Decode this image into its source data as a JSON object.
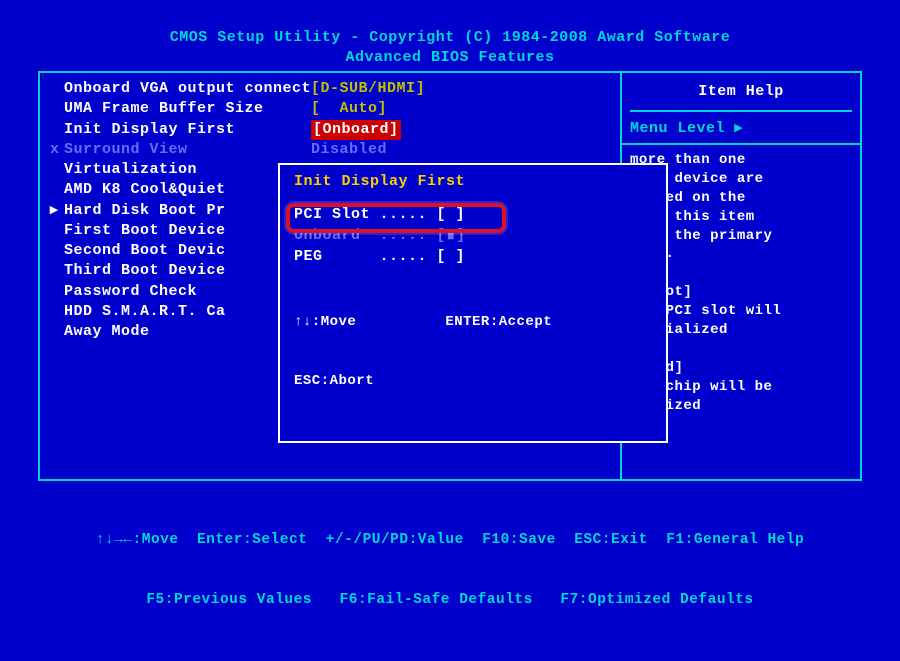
{
  "header": {
    "line1": "CMOS Setup Utility - Copyright (C) 1984-2008 Award Software",
    "line2": "Advanced BIOS Features"
  },
  "menu": {
    "items": [
      {
        "marker": " ",
        "label": "Onboard VGA output connect",
        "value": "[D-SUB/HDMI]",
        "hl": false
      },
      {
        "marker": " ",
        "label": "UMA Frame Buffer Size     ",
        "value": "[  Auto]",
        "hl": false
      },
      {
        "marker": " ",
        "label": "Init Display First        ",
        "value": "[Onboard]",
        "hl": true
      },
      {
        "marker": "x",
        "label": "Surround View             ",
        "value": "Disabled",
        "disabled": true
      },
      {
        "marker": " ",
        "label": "Virtualization",
        "value": ""
      },
      {
        "marker": " ",
        "label": "AMD K8 Cool&Quiet",
        "value": ""
      },
      {
        "marker": "▸",
        "label": "Hard Disk Boot Pr",
        "value": ""
      },
      {
        "marker": " ",
        "label": "First Boot Device",
        "value": ""
      },
      {
        "marker": " ",
        "label": "Second Boot Devic",
        "value": ""
      },
      {
        "marker": " ",
        "label": "Third Boot Device",
        "value": ""
      },
      {
        "marker": " ",
        "label": "Password Check",
        "value": ""
      },
      {
        "marker": " ",
        "label": "HDD S.M.A.R.T. Ca",
        "value": ""
      },
      {
        "marker": " ",
        "label": "Away Mode",
        "value": ""
      }
    ]
  },
  "popup": {
    "title": "Init Display First",
    "rows": [
      {
        "label": "PCI Slot ..... [ ]",
        "dim": false
      },
      {
        "label": "Onboard  ..... [∎]",
        "dim": true
      },
      {
        "label": "PEG      ..... [ ]",
        "dim": false
      }
    ],
    "hints_line1": "↑↓:Move          ENTER:Accept",
    "hints_line2": "ESC:Abort"
  },
  "help": {
    "title": "Item Help",
    "menu_level": "Menu Level   ▸",
    "body": "more than one\nplay device are\ntalled on the\ntem, this item\nects the primary\nplay.\n\nI Slot]\n on PCI slot will\ninitialized\n\nboard]\n on chip will be\ntialized"
  },
  "footer": {
    "line1": "↑↓→←:Move  Enter:Select  +/-/PU/PD:Value  F10:Save  ESC:Exit  F1:General Help",
    "line2": "F5:Previous Values   F6:Fail-Safe Defaults   F7:Optimized Defaults"
  }
}
